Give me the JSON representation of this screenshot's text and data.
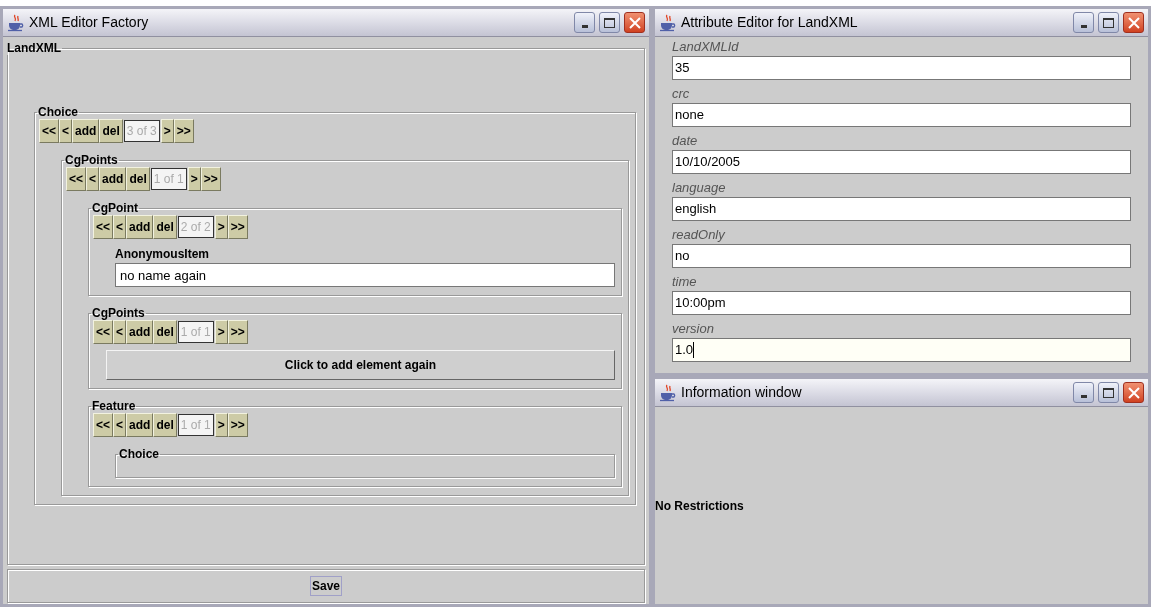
{
  "factory": {
    "title": "XML Editor Factory",
    "root": {
      "title": "LandXML",
      "children": [
        {
          "kind": "group",
          "title": "Choice",
          "nav": {
            "before": [
              "<<",
              "<",
              "add",
              "del"
            ],
            "counter": "3 of 3",
            "after": [
              ">",
              ">>"
            ]
          },
          "children": [
            {
              "kind": "group",
              "title": "CgPoints",
              "nav": {
                "before": [
                  "<<",
                  "<",
                  "add",
                  "del"
                ],
                "counter": "1 of 1",
                "after": [
                  ">",
                  ">>"
                ]
              },
              "children": [
                {
                  "kind": "group",
                  "title": "CgPoint",
                  "nav": {
                    "before": [
                      "<<",
                      "<",
                      "add",
                      "del"
                    ],
                    "counter": "2 of 2",
                    "after": [
                      ">",
                      ">>"
                    ]
                  },
                  "children": [
                    {
                      "kind": "field",
                      "label": "AnonymousItem",
                      "value": "no name again"
                    }
                  ]
                },
                {
                  "kind": "group",
                  "title": "CgPoints",
                  "nav": {
                    "before": [
                      "<<",
                      "<",
                      "add",
                      "del"
                    ],
                    "counter": "1 of 1",
                    "after": [
                      ">",
                      ">>"
                    ]
                  },
                  "children": [
                    {
                      "kind": "add_button",
                      "label": "Click to add element again"
                    }
                  ]
                },
                {
                  "kind": "group",
                  "title": "Feature",
                  "nav": {
                    "before": [
                      "<<",
                      "<",
                      "add",
                      "del"
                    ],
                    "counter": "1 of 1",
                    "after": [
                      ">",
                      ">>"
                    ]
                  },
                  "children": [
                    {
                      "kind": "group",
                      "title": "Choice"
                    }
                  ]
                }
              ]
            }
          ]
        }
      ]
    },
    "save_button": "Save"
  },
  "attribute_editor": {
    "title": "Attribute Editor for LandXML",
    "attributes": [
      {
        "label": "LandXMLId",
        "value": "35",
        "focused": false
      },
      {
        "label": "crc",
        "value": "none",
        "focused": false
      },
      {
        "label": "date",
        "value": "10/10/2005",
        "focused": false
      },
      {
        "label": "language",
        "value": "english",
        "focused": false
      },
      {
        "label": "readOnly",
        "value": "no",
        "focused": false
      },
      {
        "label": "time",
        "value": "10:00pm",
        "focused": false
      },
      {
        "label": "version",
        "value": "1.0",
        "focused": true
      }
    ]
  },
  "information_window": {
    "title": "Information window",
    "message": "No Restrictions"
  }
}
